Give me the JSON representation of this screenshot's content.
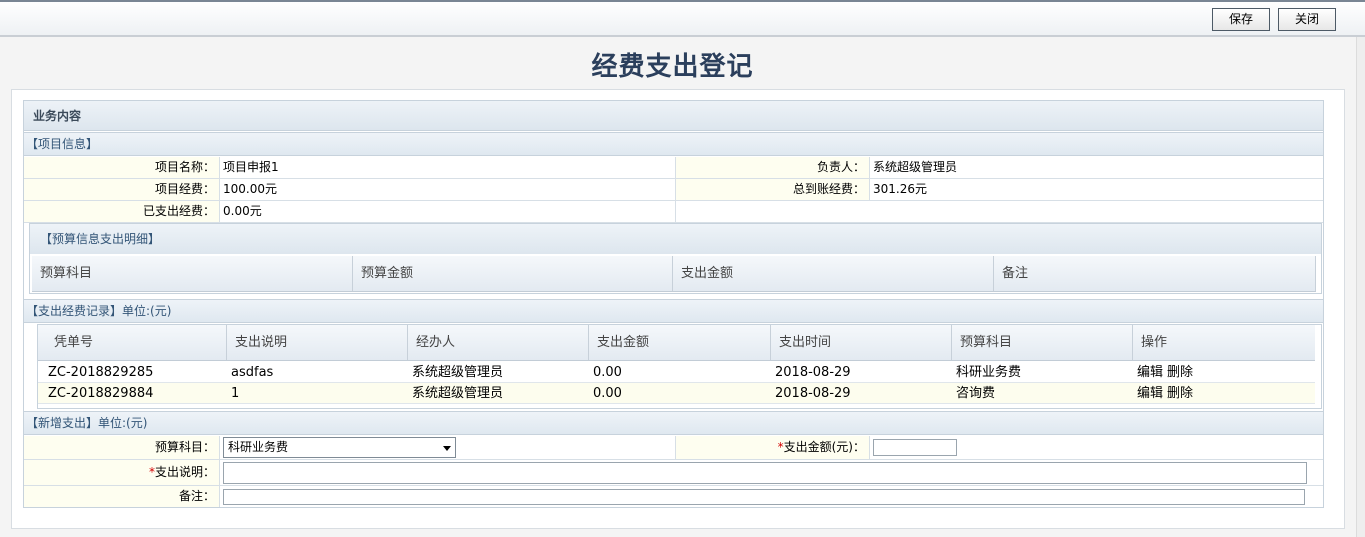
{
  "toolbar": {
    "save_label": "保存",
    "close_label": "关闭"
  },
  "page": {
    "title": "经费支出登记"
  },
  "business": {
    "title": "业务内容",
    "project_section": "【项目信息】",
    "fields": {
      "project_name_label": "项目名称：",
      "project_name": "项目申报1",
      "owner_label": "负责人：",
      "owner": "系统超级管理员",
      "funding_label": "项目经费：",
      "funding": "100.00元",
      "received_label": "总到账经费：",
      "received": "301.26元",
      "spent_label": "已支出经费：",
      "spent": "0.00元"
    },
    "budget_detail": {
      "title": "【预算信息支出明细】",
      "columns": [
        "预算科目",
        "预算金额",
        "支出金额",
        "备注"
      ]
    },
    "expense_records": {
      "title": "【支出经费记录】单位:(元)",
      "columns": [
        "凭单号",
        "支出说明",
        "经办人",
        "支出金额",
        "支出时间",
        "预算科目",
        "操作"
      ],
      "rows": [
        {
          "voucher": "ZC-2018829285",
          "desc": "asdfas",
          "handler": "系统超级管理员",
          "amount": "0.00",
          "date": "2018-08-29",
          "subject": "科研业务费",
          "edit": "编辑",
          "delete": "删除"
        },
        {
          "voucher": "ZC-2018829884",
          "desc": "1",
          "handler": "系统超级管理员",
          "amount": "0.00",
          "date": "2018-08-29",
          "subject": "咨询费",
          "edit": "编辑",
          "delete": "删除"
        }
      ]
    },
    "new_expense": {
      "title": "【新增支出】单位:(元)",
      "subject_label": "预算科目：",
      "subject_value": "科研业务费",
      "required_mark": "*",
      "amount_label": "支出金额(元)：",
      "amount_value": "",
      "desc_label": "支出说明：",
      "desc_value": "",
      "remark_label": "备注：",
      "remark_value": ""
    }
  },
  "colors": {
    "title": "#2b3f5c",
    "section_text": "#335577",
    "label_bg": "#fefef0",
    "required": "#d40000"
  }
}
